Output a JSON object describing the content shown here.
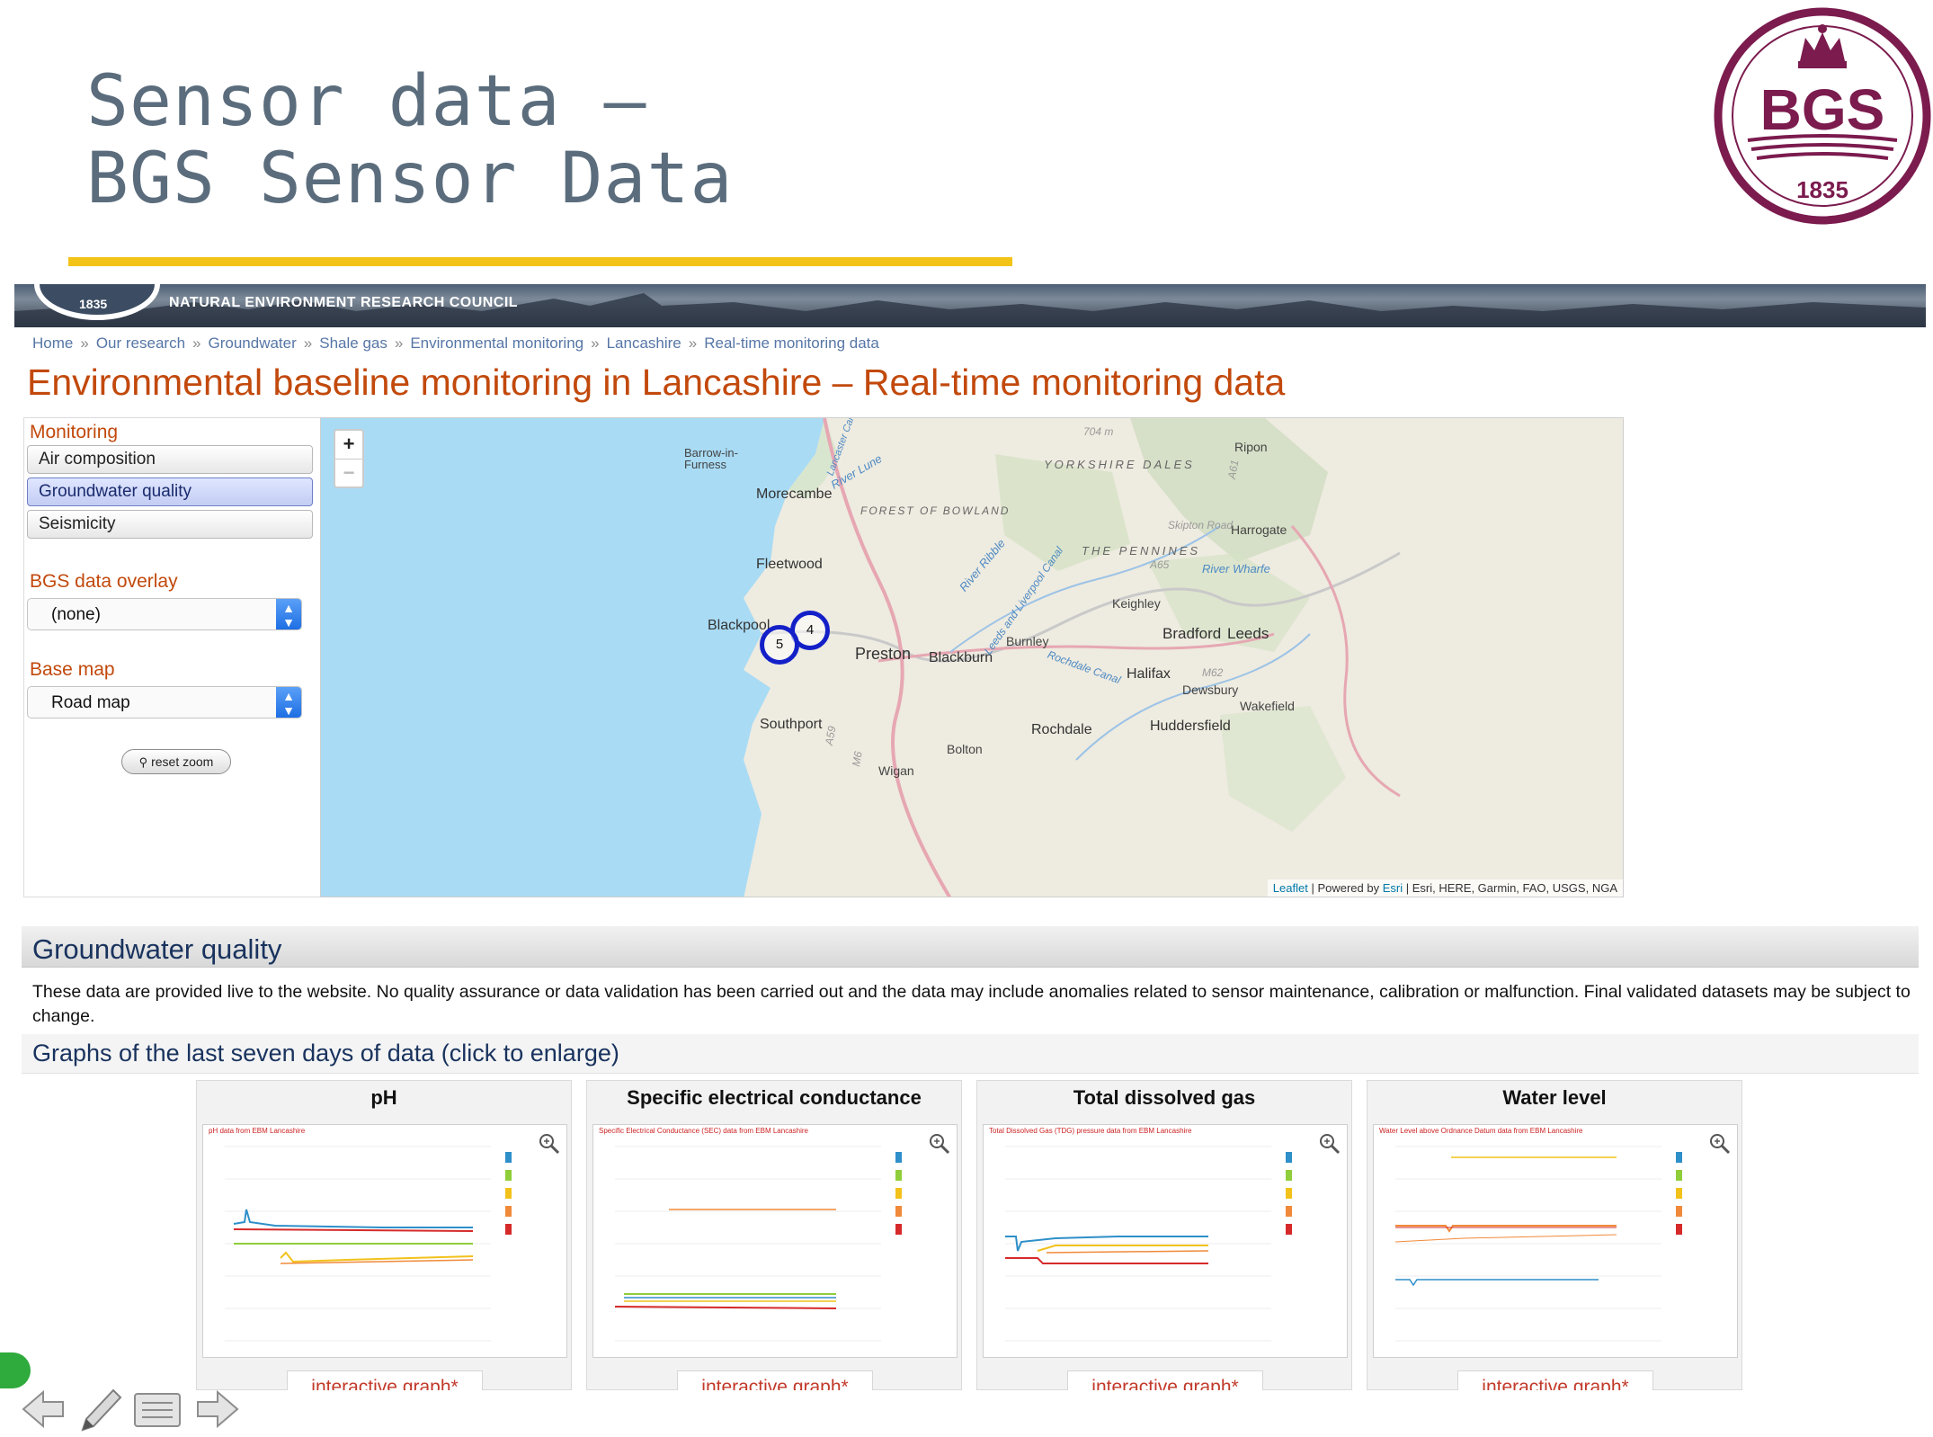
{
  "slide": {
    "title_line1": "Sensor data –",
    "title_line2": "BGS Sensor Data",
    "accent_color": "#f3c318",
    "logo_text": "BGS",
    "logo_year": "1835",
    "logo_color": "#7b1b4e"
  },
  "site": {
    "banner_text": "NATURAL ENVIRONMENT RESEARCH COUNCIL",
    "banner_year": "1835",
    "breadcrumb": [
      "Home",
      "Our research",
      "Groundwater",
      "Shale gas",
      "Environmental monitoring",
      "Lancashire",
      "Real-time monitoring data"
    ],
    "breadcrumb_sep": "»",
    "heading": "Environmental baseline monitoring in Lancashire – Real-time monitoring data"
  },
  "panel": {
    "monitoring_label": "Monitoring",
    "monitoring_items": [
      "Air composition",
      "Groundwater quality",
      "Seismicity"
    ],
    "active_item": "Groundwater quality",
    "overlay_label": "BGS data overlay",
    "overlay_value": "(none)",
    "basemap_label": "Base map",
    "basemap_value": "Road map",
    "reset_zoom_label": "reset zoom"
  },
  "map": {
    "zoom_in": "+",
    "zoom_out": "−",
    "places": [
      "Barrow-in-Furness",
      "Morecambe",
      "Fleetwood",
      "Blackpool",
      "Preston",
      "Blackburn",
      "Burnley",
      "Southport",
      "Bolton",
      "Wigan",
      "Rochdale",
      "Halifax",
      "Dewsbury",
      "Huddersfield",
      "Bradford",
      "Leeds",
      "Keighley",
      "Harrogate",
      "Ripon",
      "Wakefield"
    ],
    "regions": [
      "YORKSHIRE DALES",
      "FOREST OF BOWLAND",
      "THE PENNINES"
    ],
    "rivers": [
      "River Lune",
      "River Ribble",
      "River Wharfe",
      "Leeds and Liverpool Canal",
      "Rochdale Canal",
      "Lancaster Canal"
    ],
    "elevation": "704 m",
    "road_labels": [
      "Skipton Road",
      "A65",
      "A61",
      "M62",
      "A59",
      "M6"
    ],
    "clusters": [
      {
        "count": "4"
      },
      {
        "count": "5"
      }
    ],
    "attribution_leaflet": "Leaflet",
    "attribution_powered": "| Powered by",
    "attribution_esri": "Esri",
    "attribution_sources": "| Esri, HERE, Garmin, FAO, USGS, NGA"
  },
  "groundwater": {
    "title": "Groundwater quality",
    "disclaimer": "These data are provided live to the website. No quality assurance or data validation has been carried out and the data may include anomalies related to sensor maintenance, calibration or malfunction. Final validated datasets may be subject to change.",
    "graphs_title": "Graphs of the last seven days of data (click to enlarge)",
    "cards": [
      {
        "title": "pH",
        "chart_title": "pH data from EBM Lancashire",
        "link": "interactive graph*"
      },
      {
        "title": "Specific electrical conductance",
        "chart_title": "Specific Electrical Conductance (SEC) data from EBM Lancashire",
        "link": "interactive graph*"
      },
      {
        "title": "Total dissolved gas",
        "chart_title": "Total Dissolved Gas (TDG) pressure data from EBM Lancashire",
        "link": "interactive graph*"
      },
      {
        "title": "Water level",
        "chart_title": "Water Level above Ordnance Datum data from EBM Lancashire",
        "link": "interactive graph*"
      }
    ],
    "series_colors": [
      "#2e8fc9",
      "#8fce3a",
      "#f2c21b",
      "#f08a3a",
      "#d62a2a"
    ]
  },
  "nav": {
    "icons": [
      "back-arrow-icon",
      "pen-icon",
      "menu-icon",
      "forward-arrow-icon"
    ]
  }
}
